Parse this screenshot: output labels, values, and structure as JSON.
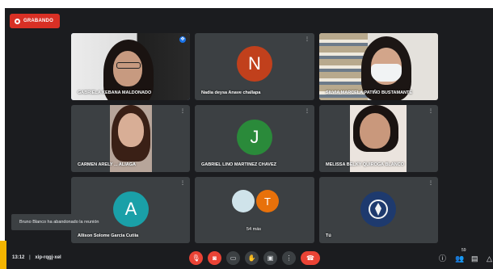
{
  "recording": {
    "label": "GRABANDO"
  },
  "tiles": [
    {
      "name": "GABRIELA KEBANA MALDONADO"
    },
    {
      "name": "Nadia deysa Anave challapa",
      "initial": "N"
    },
    {
      "name": "SILVIA MARCELA PATIÑO BUSTAMANTE"
    },
    {
      "name": "CARMEN ARELY ... ALIAGA"
    },
    {
      "name": "GABRIEL LINO MARTINEZ CHAVEZ",
      "initial": "J"
    },
    {
      "name": "MELISSA BELKY QUIROGA BLANCO"
    },
    {
      "name": "Allison Solome Garcia Cutiia",
      "initial": "A"
    },
    {
      "name": "54 más",
      "initial": "T"
    },
    {
      "name": "Tú"
    }
  ],
  "toast": {
    "text": "Bruno Blanco ha abandonado la reunión"
  },
  "meeting": {
    "time": "13:12",
    "separator": "|",
    "code": "xip-rqgj-xel"
  },
  "participants_badge": "59",
  "colors": {
    "recording": "#d93025",
    "end_call": "#ea4335",
    "avatar_n": "#c1401c",
    "avatar_j": "#2a8a3a",
    "avatar_a": "#1aa0a8",
    "avatar_t": "#e8710a",
    "user_logo": "#1e3a6e"
  }
}
